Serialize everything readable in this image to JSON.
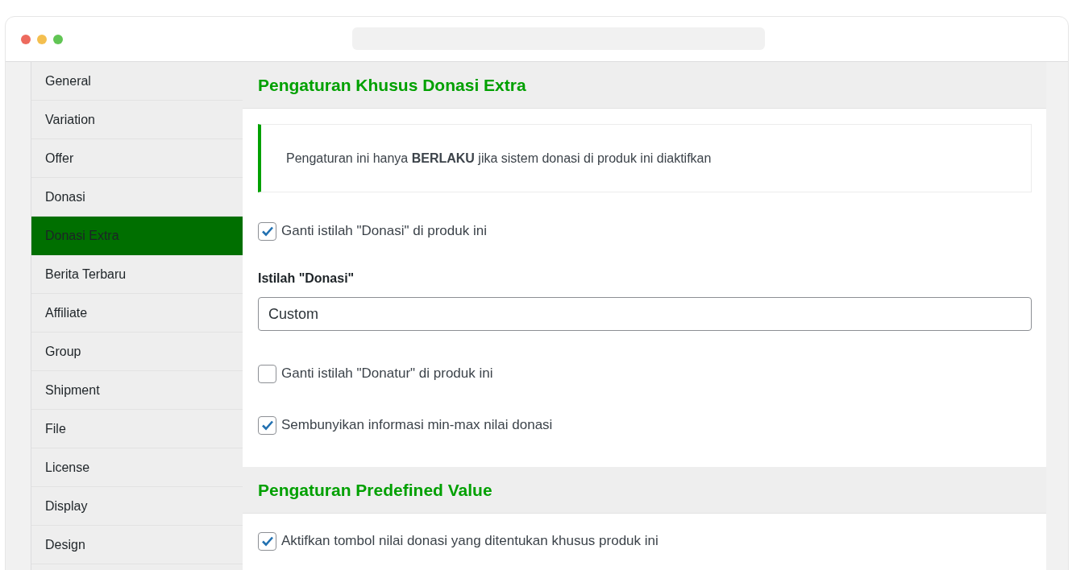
{
  "window": {
    "controls": [
      {
        "color": "#ed6a5e"
      },
      {
        "color": "#f4bf4f"
      },
      {
        "color": "#61c554"
      }
    ]
  },
  "sidebar": {
    "items": [
      {
        "label": "General",
        "selected": false
      },
      {
        "label": "Variation",
        "selected": false
      },
      {
        "label": "Offer",
        "selected": false
      },
      {
        "label": "Donasi",
        "selected": false
      },
      {
        "label": "Donasi Extra",
        "selected": true
      },
      {
        "label": "Berita Terbaru",
        "selected": false
      },
      {
        "label": "Affiliate",
        "selected": false
      },
      {
        "label": "Group",
        "selected": false
      },
      {
        "label": "Shipment",
        "selected": false
      },
      {
        "label": "File",
        "selected": false
      },
      {
        "label": "License",
        "selected": false
      },
      {
        "label": "Display",
        "selected": false
      },
      {
        "label": "Design",
        "selected": false
      }
    ]
  },
  "sections": [
    {
      "title": "Pengaturan Khusus Donasi Extra",
      "items": [
        {
          "kind": "notice",
          "text": "Pengaturan ini hanya **BERLAKU** jika sistem donasi di produk ini diaktifkan"
        },
        {
          "kind": "checkbox",
          "label": "Ganti istilah \"Donasi\" di produk ini",
          "checked": true
        },
        {
          "kind": "field",
          "label": "Istilah \"Donasi\"",
          "value": "Custom"
        },
        {
          "kind": "checkbox",
          "label": "Ganti istilah \"Donatur\" di produk ini",
          "checked": false
        },
        {
          "kind": "checkbox",
          "label": "Sembunyikan informasi min-max nilai donasi",
          "checked": true
        }
      ]
    },
    {
      "title": "Pengaturan Predefined Value",
      "items": [
        {
          "kind": "checkbox",
          "label": "Aktifkan tombol nilai donasi yang ditentukan khusus produk ini",
          "checked": true
        }
      ]
    }
  ]
}
